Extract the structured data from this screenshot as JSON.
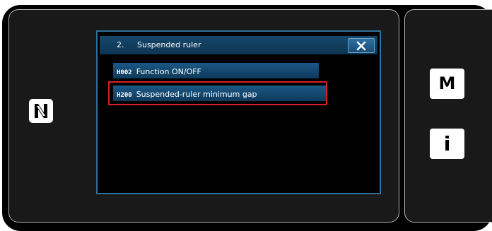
{
  "nfc_mark": {
    "icon": "nfc-n-mark-icon"
  },
  "dialog": {
    "number": "2.",
    "title": "Suspended ruler",
    "close_icon": "close-x-icon",
    "items": [
      {
        "code": "H002",
        "label": "Function ON/OFF",
        "selected": false
      },
      {
        "code": "H200",
        "label": "Suspended-ruler minimum gap",
        "selected": true
      }
    ]
  },
  "side_buttons": {
    "mode_label": "M",
    "info_label": "i"
  },
  "colors": {
    "highlight_border": "#d6202a",
    "button_blue": "#1b5885",
    "dialog_border": "#2f6f9c"
  }
}
